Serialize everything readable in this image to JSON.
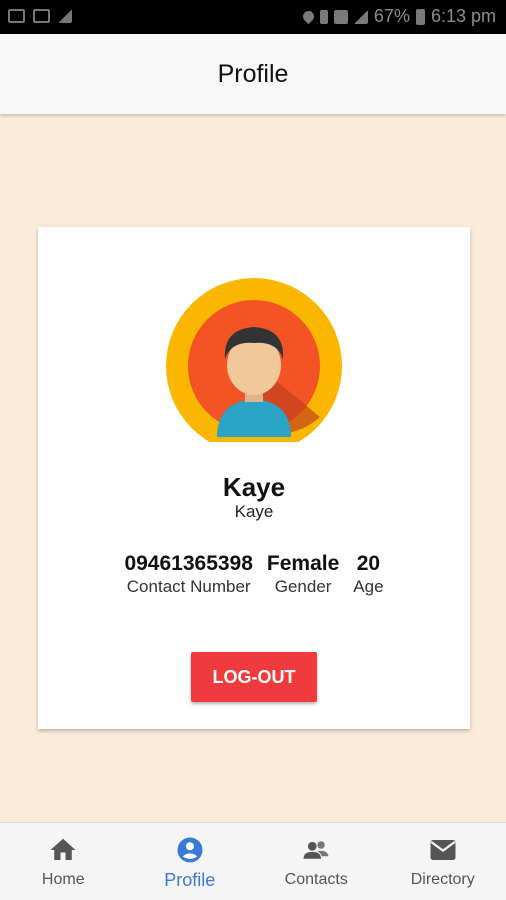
{
  "status_bar": {
    "battery": "67%",
    "time": "6:13 pm"
  },
  "app_bar": {
    "title": "Profile"
  },
  "profile": {
    "name": "Kaye",
    "subname": "Kaye",
    "stats": [
      {
        "value": "09461365398",
        "label": "Contact Number"
      },
      {
        "value": "Female",
        "label": "Gender"
      },
      {
        "value": "20",
        "label": "Age"
      }
    ],
    "logout_label": "LOG-OUT"
  },
  "bottom_nav": {
    "items": [
      {
        "label": "Home",
        "icon": "home-icon",
        "active": false
      },
      {
        "label": "Profile",
        "icon": "account-circle-icon",
        "active": true
      },
      {
        "label": "Contacts",
        "icon": "contacts-icon",
        "active": false
      },
      {
        "label": "Directory",
        "icon": "mail-icon",
        "active": false
      }
    ]
  },
  "colors": {
    "background": "#fbebd8",
    "accent_active": "#3a7bd5",
    "logout_button": "#ef3b3d",
    "avatar_ring": "#fbb700",
    "avatar_inner": "#f35325"
  }
}
